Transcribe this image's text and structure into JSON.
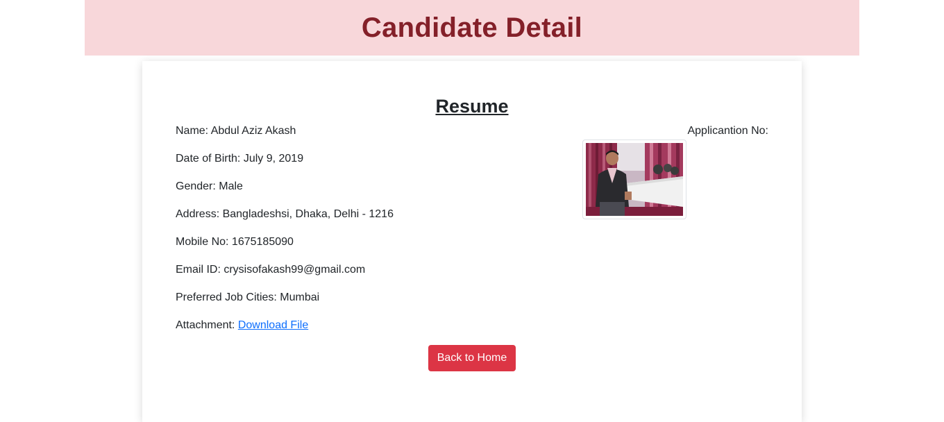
{
  "header": {
    "title": "Candidate Detail"
  },
  "resume": {
    "title": "Resume",
    "application_label": "Applicantion No:",
    "fields": {
      "name": "Name: Abdul Aziz Akash",
      "dob": "Date of Birth: July 9, 2019",
      "gender": "Gender: Male",
      "address": "Address: Bangladeshsi, Dhaka, Delhi - 1216",
      "mobile": "Mobile No: 1675185090",
      "email": "Email ID: crysisofakash99@gmail.com",
      "cities": "Preferred Job Cities: Mumbai",
      "attachment_label": "Attachment: ",
      "attachment_link": "Download File"
    },
    "back_button": "Back to Home"
  },
  "colors": {
    "header_bg": "#f8d7da",
    "header_text": "#842029",
    "button_bg": "#dc3545",
    "link": "#0d6efd"
  }
}
